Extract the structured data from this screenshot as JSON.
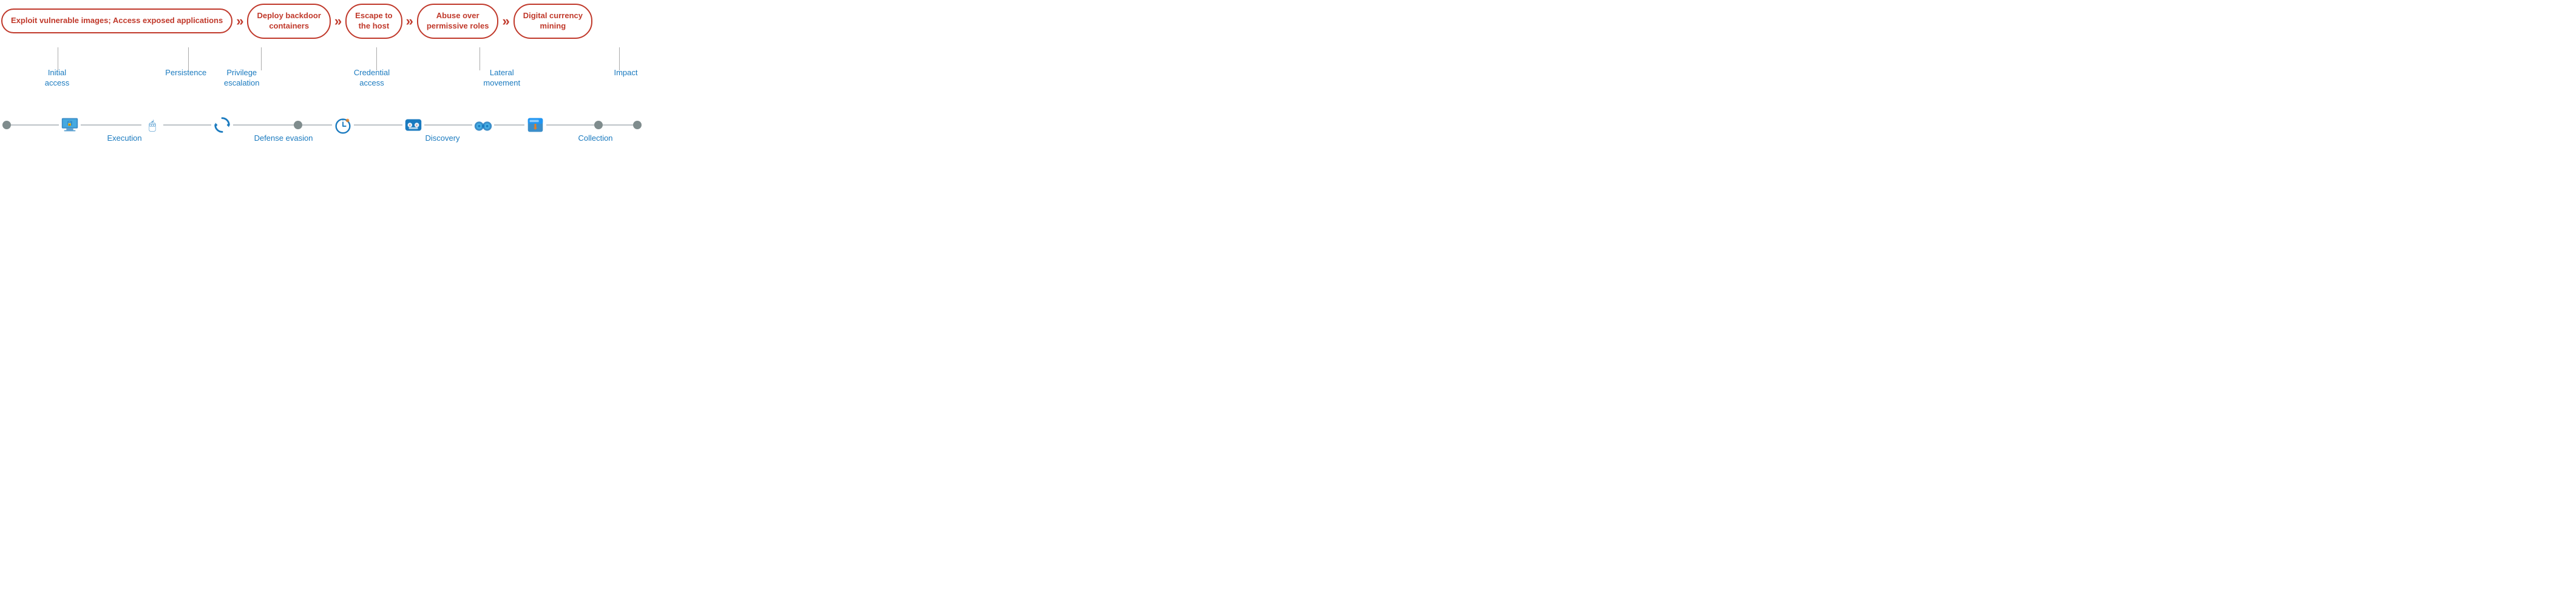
{
  "bubbles": [
    {
      "id": "bubble-1",
      "text": "Exploit vulnerable images;\nAccess exposed applications"
    },
    {
      "id": "bubble-2",
      "text": "Deploy backdoor\ncontainers"
    },
    {
      "id": "bubble-3",
      "text": "Escape to\nthe host"
    },
    {
      "id": "bubble-4",
      "text": "Abuse over\npermissive roles"
    },
    {
      "id": "bubble-5",
      "text": "Digital currency\nmining"
    }
  ],
  "middle_labels": [
    {
      "id": "ml-1",
      "text": "Initial access"
    },
    {
      "id": "ml-2",
      "text": "Persistence"
    },
    {
      "id": "ml-3",
      "text": "Privilege\nescalation"
    },
    {
      "id": "ml-4",
      "text": "Credential\naccess"
    },
    {
      "id": "ml-5",
      "text": "Lateral\nmovement"
    },
    {
      "id": "ml-6",
      "text": "Impact"
    }
  ],
  "bottom_labels": [
    {
      "id": "bl-1",
      "text": "Execution"
    },
    {
      "id": "bl-2",
      "text": "Defense evasion"
    },
    {
      "id": "bl-3",
      "text": "Discovery"
    },
    {
      "id": "bl-4",
      "text": "Collection"
    }
  ],
  "arrows": [
    "»",
    "»",
    "»",
    "»"
  ],
  "colors": {
    "bubble_border": "#c0392b",
    "bubble_text": "#c0392b",
    "label_text": "#1a7abf",
    "timeline": "#bdc3c7",
    "dot": "#7f8c8d"
  }
}
